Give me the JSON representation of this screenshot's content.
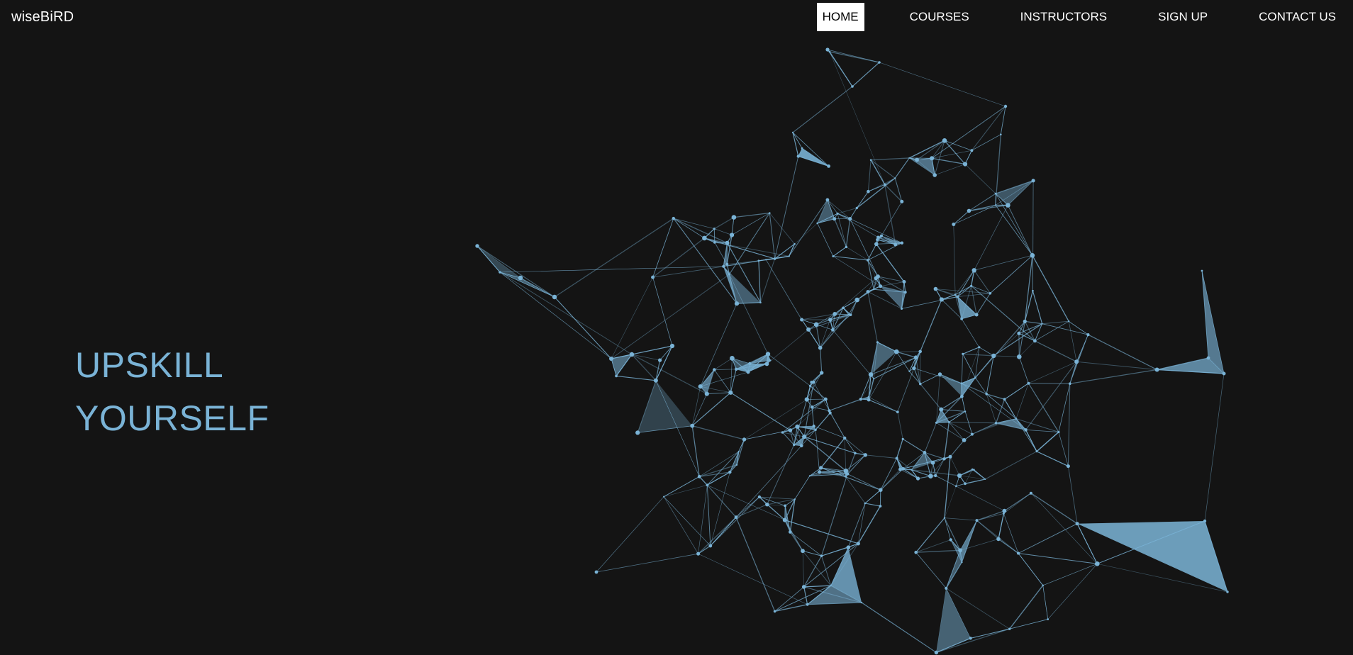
{
  "brand": {
    "name": "wiseBiRD"
  },
  "nav": {
    "items": [
      {
        "label": "HOME",
        "active": true
      },
      {
        "label": "COURSES",
        "active": false
      },
      {
        "label": "INSTRUCTORS",
        "active": false
      },
      {
        "label": "SIGN UP",
        "active": false
      },
      {
        "label": "CONTACT US",
        "active": false
      }
    ]
  },
  "hero": {
    "headline_line1": "UPSKILL",
    "headline_line2": "YOURSELF"
  },
  "theme": {
    "background": "#141414",
    "accent": "#7ab3d6",
    "nav_active_bg": "#ffffff",
    "nav_active_text": "#000000"
  },
  "background_art": {
    "icon": "particle-network-icon"
  }
}
